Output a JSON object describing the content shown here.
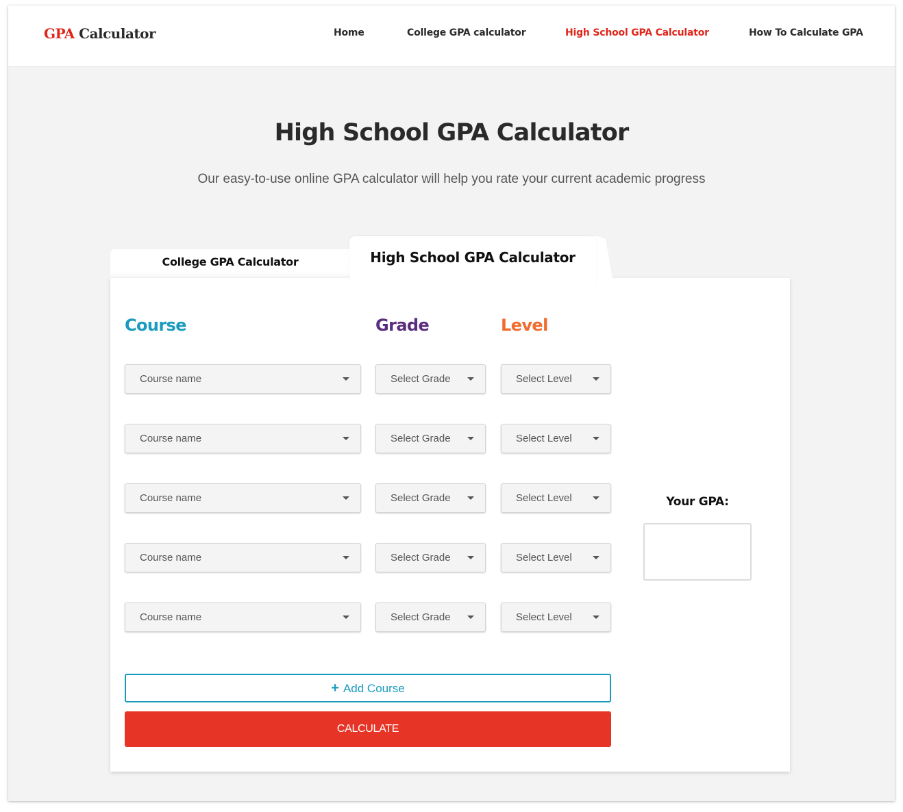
{
  "header": {
    "logo": {
      "part1": "GPA",
      "part2": "Calculator"
    },
    "nav": [
      {
        "label": "Home",
        "active": false
      },
      {
        "label": "College GPA calculator",
        "active": false
      },
      {
        "label": "High School GPA Calculator",
        "active": true
      },
      {
        "label": "How To Calculate GPA",
        "active": false
      }
    ]
  },
  "hero": {
    "title": "High School GPA Calculator",
    "subtitle": "Our easy-to-use online GPA calculator will help you rate your current academic progress"
  },
  "tabs": [
    {
      "label": "College GPA Calculator",
      "active": false
    },
    {
      "label": "High School GPA Calculator",
      "active": true
    }
  ],
  "columns": {
    "course": "Course",
    "grade": "Grade",
    "level": "Level"
  },
  "rows": [
    {
      "course": "Course name",
      "grade": "Select Grade",
      "level": "Select Level"
    },
    {
      "course": "Course name",
      "grade": "Select Grade",
      "level": "Select Level"
    },
    {
      "course": "Course name",
      "grade": "Select Grade",
      "level": "Select Level"
    },
    {
      "course": "Course name",
      "grade": "Select Grade",
      "level": "Select Level"
    },
    {
      "course": "Course name",
      "grade": "Select Grade",
      "level": "Select Level"
    }
  ],
  "result": {
    "label": "Your GPA:",
    "value": ""
  },
  "buttons": {
    "add_icon": "+",
    "add_course": "Add Course",
    "calculate": "CALCULATE"
  },
  "colors": {
    "brand_red": "#e0261b",
    "course_teal": "#1a9bbf",
    "grade_purple": "#5a2d7e",
    "level_orange": "#ef6c2e",
    "calculate_red": "#e63426"
  }
}
